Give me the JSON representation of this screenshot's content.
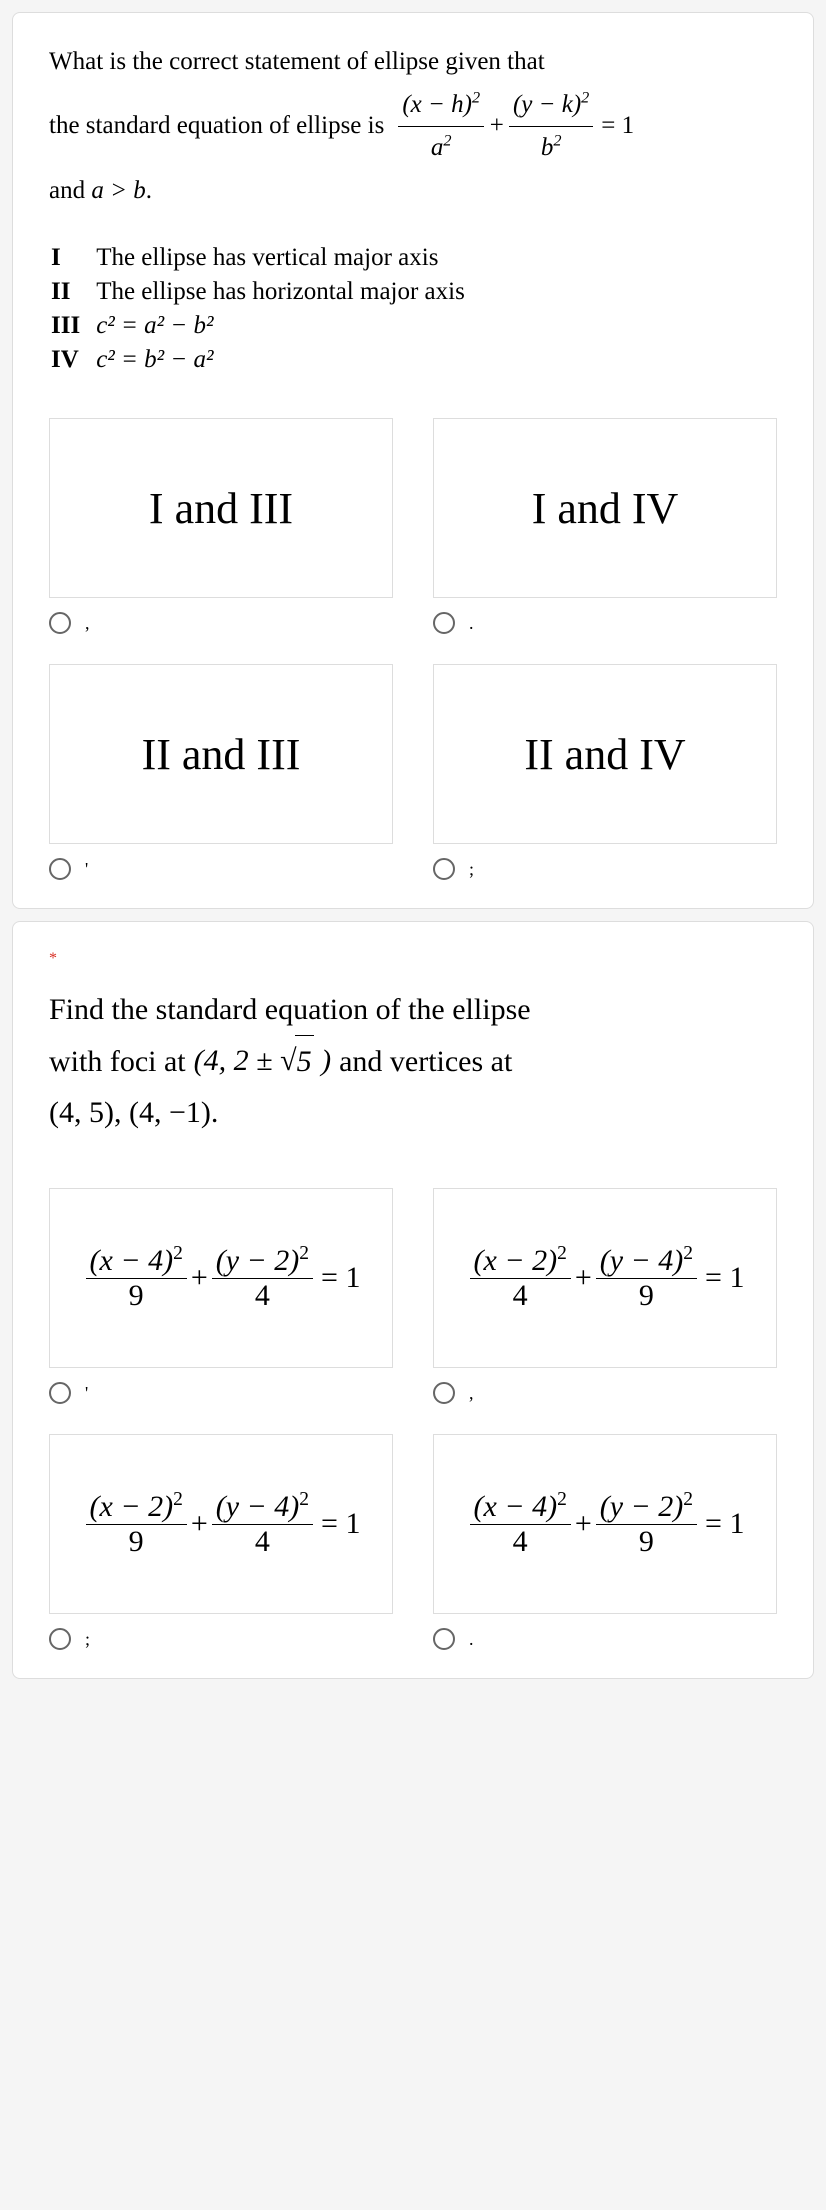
{
  "q1": {
    "prompt_line1": "What is the correct statement of ellipse given that",
    "prompt_line2_a": "the standard equation of ellipse is",
    "eq_num1": "(x − h)",
    "eq_den1": "a",
    "eq_num2": "(y − k)",
    "eq_den2": "b",
    "eq_rhs": "= 1",
    "prompt_line3_a": "and",
    "prompt_line3_b": "a > b",
    "prompt_line3_c": ".",
    "statements": [
      {
        "rn": "I",
        "text": "The ellipse has vertical major axis"
      },
      {
        "rn": "II",
        "text": "The ellipse has horizontal major axis"
      },
      {
        "rn": "III",
        "text": "c² = a² − b²"
      },
      {
        "rn": "IV",
        "text": "c² = b² − a²"
      }
    ],
    "options": [
      {
        "label": "I and III",
        "mark": ","
      },
      {
        "label": "I and IV",
        "mark": "."
      },
      {
        "label": "II and III",
        "mark": "'"
      },
      {
        "label": "II and IV",
        "mark": ";"
      }
    ]
  },
  "q2": {
    "required": "*",
    "prompt_a": "Find the standard equation of the ellipse",
    "prompt_b": "with foci at",
    "foci": "(4, 2 ± √5)",
    "foci_open": "(4, 2 ±",
    "foci_rad": "5",
    "foci_close": ")",
    "prompt_c": "and vertices at",
    "vertices": "(4, 5), (4, −1).",
    "options": [
      {
        "n1": "(x − 4)",
        "d1": "9",
        "n2": "(y − 2)",
        "d2": "4",
        "rhs": "= 1",
        "mark": "'"
      },
      {
        "n1": "(x − 2)",
        "d1": "4",
        "n2": "(y − 4)",
        "d2": "9",
        "rhs": "= 1",
        "mark": ","
      },
      {
        "n1": "(x − 2)",
        "d1": "9",
        "n2": "(y − 4)",
        "d2": "4",
        "rhs": "= 1",
        "mark": ";"
      },
      {
        "n1": "(x − 4)",
        "d1": "4",
        "n2": "(y − 2)",
        "d2": "9",
        "rhs": "= 1",
        "mark": "."
      }
    ]
  }
}
